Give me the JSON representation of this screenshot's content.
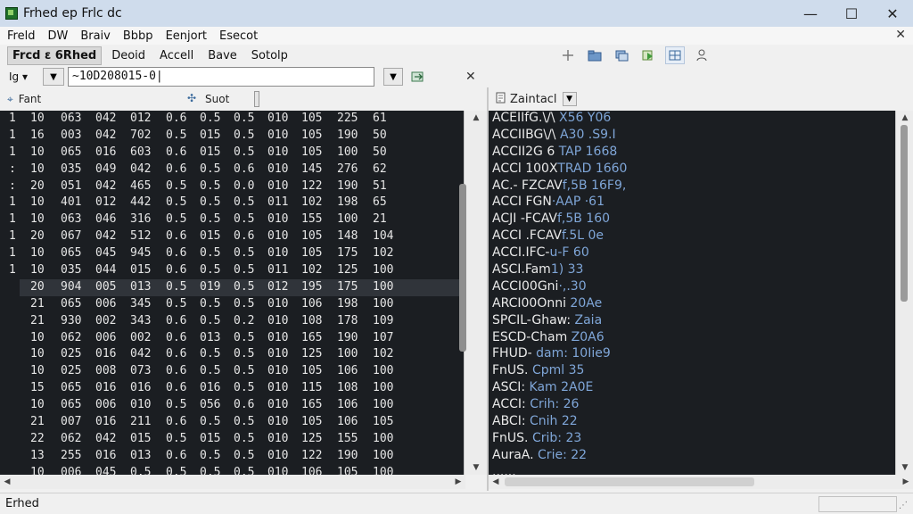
{
  "window": {
    "title": "Frhed ep Frlc dc",
    "controls": {
      "minimize": "—",
      "maximize": "☐",
      "close": "✕"
    }
  },
  "menu": {
    "items": [
      "Freld",
      "DW",
      "Braiv",
      "Bbbp",
      "Eenjort",
      "Esecot"
    ],
    "close": "✕"
  },
  "toolbar": {
    "buttons": [
      "Frcd ε 6Rhed",
      "Deoid",
      "Accell",
      "Bave",
      "Sotolp"
    ],
    "icons": [
      "plus-icon",
      "folder-icon",
      "stack-icon",
      "green-arrow-icon",
      "grid-icon",
      "person-icon"
    ]
  },
  "address": {
    "mode": "Ig ▾",
    "value": "~10D208015-0|",
    "close": "✕"
  },
  "panels": {
    "left_header": "Fant",
    "left_header2": "Suot",
    "right_header": "Zaintacl"
  },
  "hex_rows": [
    [
      "1",
      "10",
      "063",
      "042",
      "012",
      "0.6",
      "0.5",
      "0.5",
      "010",
      "105",
      "225",
      "61"
    ],
    [
      "1",
      "16",
      "003",
      "042",
      "702",
      "0.5",
      "015",
      "0.5",
      "010",
      "105",
      "190",
      "50"
    ],
    [
      "1",
      "10",
      "065",
      "016",
      "603",
      "0.6",
      "015",
      "0.5",
      "010",
      "105",
      "100",
      "50"
    ],
    [
      ":",
      "10",
      "035",
      "049",
      "042",
      "0.6",
      "0.5",
      "0.6",
      "010",
      "145",
      "276",
      "62"
    ],
    [
      ":",
      "20",
      "051",
      "042",
      "465",
      "0.5",
      "0.5",
      "0.0",
      "010",
      "122",
      "190",
      "51"
    ],
    [
      "1",
      "10",
      "401",
      "012",
      "442",
      "0.5",
      "0.5",
      "0.5",
      "011",
      "102",
      "198",
      "65"
    ],
    [
      "1",
      "10",
      "063",
      "046",
      "316",
      "0.5",
      "0.5",
      "0.5",
      "010",
      "155",
      "100",
      "21"
    ],
    [
      "1",
      "20",
      "067",
      "042",
      "512",
      "0.6",
      "015",
      "0.6",
      "010",
      "105",
      "148",
      "104"
    ],
    [
      "1",
      "10",
      "065",
      "045",
      "945",
      "0.6",
      "0.5",
      "0.5",
      "010",
      "105",
      "175",
      "102"
    ],
    [
      "1",
      "10",
      "035",
      "044",
      "015",
      "0.6",
      "0.5",
      "0.5",
      "011",
      "102",
      "125",
      "100"
    ],
    [
      "",
      "20",
      "904",
      "005",
      "013",
      "0.5",
      "019",
      "0.5",
      "012",
      "195",
      "175",
      "100"
    ],
    [
      "",
      "21",
      "065",
      "006",
      "345",
      "0.5",
      "0.5",
      "0.5",
      "010",
      "106",
      "198",
      "100"
    ],
    [
      "",
      "21",
      "930",
      "002",
      "343",
      "0.6",
      "0.5",
      "0.2",
      "010",
      "108",
      "178",
      "109"
    ],
    [
      "",
      "10",
      "062",
      "006",
      "002",
      "0.6",
      "013",
      "0.5",
      "010",
      "165",
      "190",
      "107"
    ],
    [
      "",
      "10",
      "025",
      "016",
      "042",
      "0.6",
      "0.5",
      "0.5",
      "010",
      "125",
      "100",
      "102"
    ],
    [
      "",
      "10",
      "025",
      "008",
      "073",
      "0.6",
      "0.5",
      "0.5",
      "010",
      "105",
      "106",
      "100"
    ],
    [
      "",
      "15",
      "065",
      "016",
      "016",
      "0.6",
      "016",
      "0.5",
      "010",
      "115",
      "108",
      "100"
    ],
    [
      "",
      "10",
      "065",
      "006",
      "010",
      "0.5",
      "056",
      "0.6",
      "010",
      "165",
      "106",
      "100"
    ],
    [
      "",
      "21",
      "007",
      "016",
      "211",
      "0.6",
      "0.5",
      "0.5",
      "010",
      "105",
      "106",
      "105"
    ],
    [
      "",
      "22",
      "062",
      "042",
      "015",
      "0.5",
      "015",
      "0.5",
      "010",
      "125",
      "155",
      "100"
    ],
    [
      "",
      "13",
      "255",
      "016",
      "013",
      "0.6",
      "0.5",
      "0.5",
      "010",
      "122",
      "190",
      "100"
    ],
    [
      "",
      "10",
      "006",
      "045",
      "0.5",
      "0.5",
      "0.5",
      "0.5",
      "010",
      "106",
      "105",
      "100"
    ]
  ],
  "text_rows": [
    [
      "ACEIIfG.\\/\\ ",
      "X56 Y06"
    ],
    [
      "ACCIIBG\\/\\ ",
      "A30 .S9.I"
    ],
    [
      "ACCII2G 6 ",
      "TAP 1668"
    ],
    [
      "ACCl 100X",
      "TRAD 1660"
    ],
    [
      "AC.- FZCAV",
      "f,5B 16F9,"
    ],
    [
      "ACCI FGN",
      "·AAP ·61"
    ],
    [
      "ACJI -FCAV",
      "f,5B 160"
    ],
    [
      "ACCI .FCAV",
      "f.5L 0e"
    ],
    [
      "ACCI.IFC-",
      "u-F 60"
    ],
    [
      "ASCI.Fam",
      "1) 33"
    ],
    [
      "ACCI00Gni",
      "·,.30"
    ],
    [
      "ARCI00Onni",
      " 20Ae"
    ],
    [
      "SPCIL-Ghaw:",
      " Zaia"
    ],
    [
      "ESCD-Cham",
      " Z0A6"
    ],
    [
      "FHUD-",
      " dam: 10Iie9"
    ],
    [
      "FnUS. ",
      "Cpml 35"
    ],
    [
      "ASCI: ",
      "Kam 2A0E"
    ],
    [
      "ACCI: ",
      "Crih: 26"
    ],
    [
      "ABCI: ",
      "Cnih 22"
    ],
    [
      "FnUS. ",
      "Crib: 23"
    ],
    [
      "AuraA. ",
      "Crie: 22"
    ],
    [
      "......",
      ""
    ]
  ],
  "status": {
    "text": "Erhed",
    "grip": "⋰"
  }
}
